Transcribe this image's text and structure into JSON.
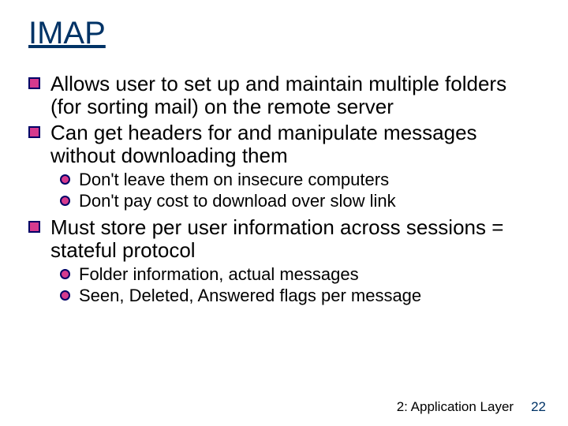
{
  "title": "IMAP",
  "bullets": {
    "b1": "Allows user to set up and maintain multiple folders (for sorting mail) on the remote server",
    "b2": "Can get headers for and manipulate messages without downloading them",
    "b2s1": "Don't leave them on insecure computers",
    "b2s2": "Don't pay cost to download over slow link",
    "b3": "Must store per user information across sessions = stateful protocol",
    "b3s1": "Folder information, actual messages",
    "b3s2": "Seen, Deleted, Answered flags per message"
  },
  "footer": {
    "section": "2: Application Layer",
    "page": "22"
  }
}
